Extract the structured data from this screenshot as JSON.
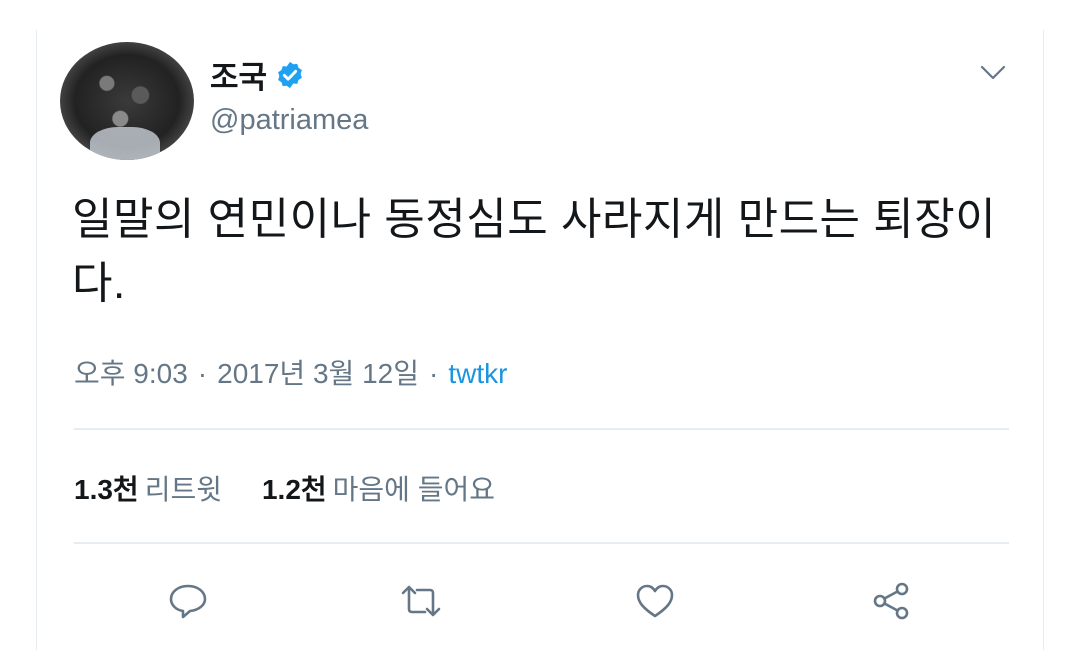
{
  "tweet": {
    "display_name": "조국",
    "handle": "@patriamea",
    "verified": true,
    "text": "일말의 연민이나 동정심도 사라지게 만드는 퇴장이다.",
    "time": "오후 9:03",
    "separator": "·",
    "date": "2017년 3월 12일",
    "source": "twtkr"
  },
  "stats": {
    "retweets_count": "1.3천",
    "retweets_label": "리트윗",
    "likes_count": "1.2천",
    "likes_label": "마음에 들어요"
  },
  "icons": {
    "verified": "verified-badge-icon",
    "more": "chevron-down-icon",
    "reply": "reply-icon",
    "retweet": "retweet-icon",
    "like": "heart-icon",
    "share": "share-icon"
  },
  "colors": {
    "accent": "#1b95e0",
    "muted": "#657786",
    "text": "#14171a",
    "divider": "#e6ecf0"
  }
}
